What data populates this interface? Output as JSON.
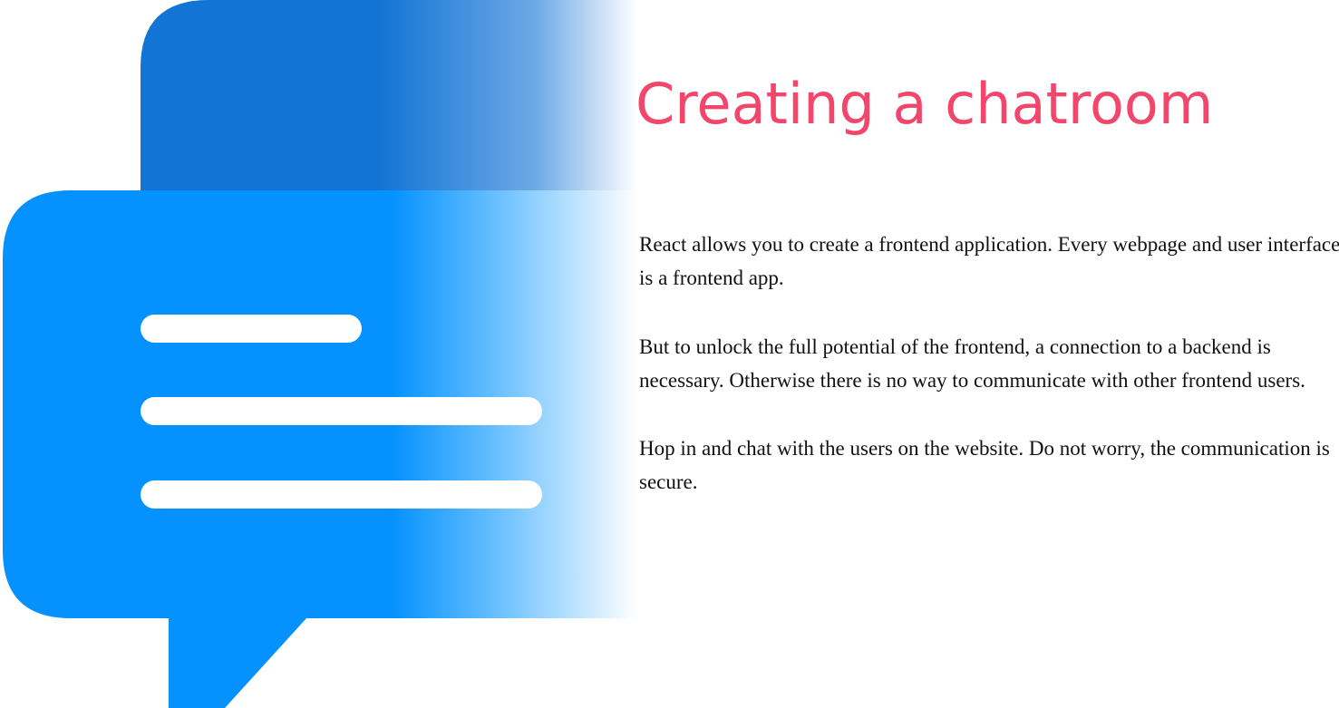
{
  "page": {
    "title": "Creating a chatroom",
    "paragraphs": [
      "React allows you to create a frontend application. Every webpage and user interface is a frontend app.",
      "But to unlock the full potential of the frontend, a connection to a backend is necessary. Otherwise there is no way to communicate with other frontend users.",
      "Hop in and chat with the users on the website. Do not worry, the communication is secure."
    ]
  },
  "hero": {
    "icon": "chat-bubbles-icon",
    "colors": {
      "back_bubble": "#1274d4",
      "front_bubble": "#0592ff",
      "text_lines": "#ffffff",
      "title": "#f2476d"
    }
  }
}
